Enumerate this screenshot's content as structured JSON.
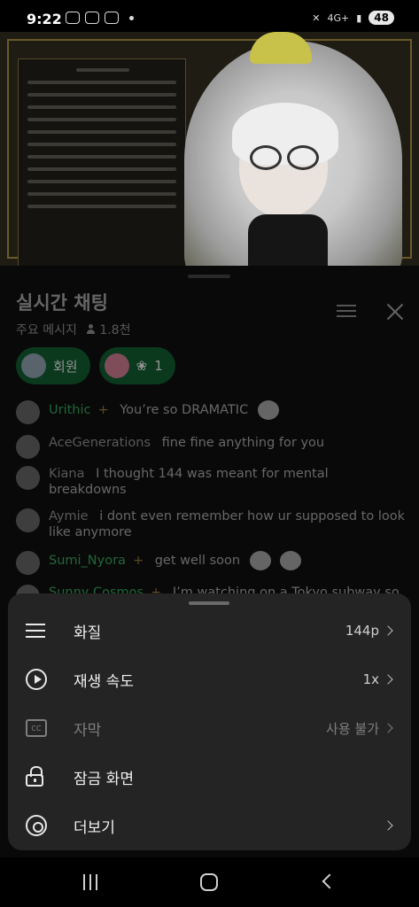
{
  "status_bar": {
    "time": "9:22",
    "network": "4G+",
    "battery": "48"
  },
  "chat": {
    "title": "실시간 채팅",
    "mode": "주요 메시지",
    "viewer_count": "1.8천",
    "chips": [
      {
        "label": "회원"
      },
      {
        "label": "1"
      }
    ],
    "messages": [
      {
        "author": "Urithic",
        "author_color": "green",
        "text": "You’re so DRAMATIC"
      },
      {
        "author": "AceGenerations",
        "author_color": "gray",
        "text": "fine fine anything for you"
      },
      {
        "author": "Kiana",
        "author_color": "gray",
        "text": "I thought 144 was meant for mental breakdowns"
      },
      {
        "author": "Aymie",
        "author_color": "gray",
        "text": "i dont even remember how ur supposed to look like anymore"
      },
      {
        "author": "Sumi_Nyora",
        "author_color": "green",
        "text": "get well soon"
      },
      {
        "author": "Sunny Cosmos",
        "author_color": "green",
        "text": "I’m watching on a Tokyo subway so"
      }
    ]
  },
  "settings_sheet": {
    "items": [
      {
        "label": "화질",
        "value": "144p",
        "icon": "quality-sliders-icon",
        "enabled": true
      },
      {
        "label": "재생 속도",
        "value": "1x",
        "icon": "playback-speed-icon",
        "enabled": true
      },
      {
        "label": "자막",
        "value": "사용 불가",
        "icon": "captions-icon",
        "enabled": false
      },
      {
        "label": "잠금 화면",
        "value": "",
        "icon": "lock-icon",
        "enabled": true
      },
      {
        "label": "더보기",
        "value": "",
        "icon": "gear-icon",
        "enabled": true
      }
    ]
  },
  "colors": {
    "accent_green": "#0f4f2a",
    "sheet_bg": "#242424",
    "member_name": "#2e8e4e"
  }
}
